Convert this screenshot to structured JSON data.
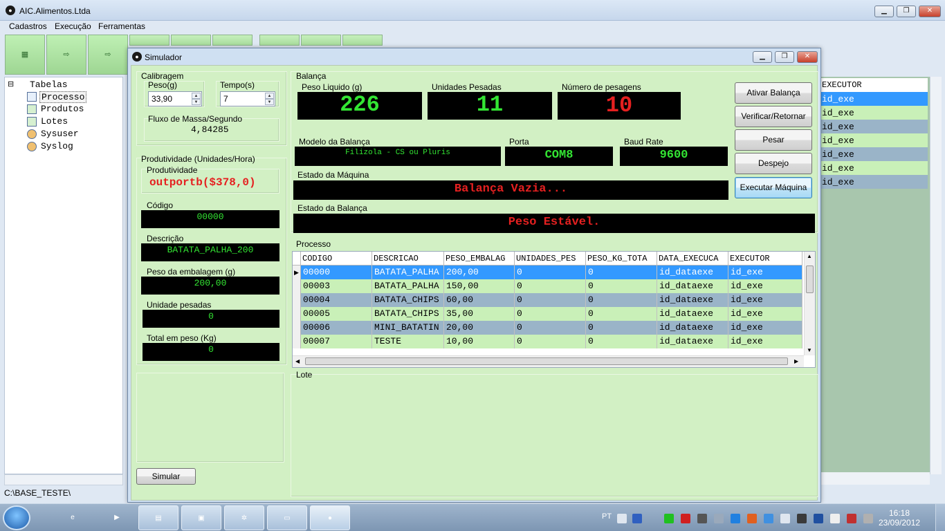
{
  "app": {
    "title": "AIC.Alimentos.Ltda"
  },
  "menu": [
    "Cadastros",
    "Execução",
    "Ferramentas"
  ],
  "tree": {
    "root": "Tabelas",
    "items": [
      "Processo",
      "Produtos",
      "Lotes",
      "Sysuser",
      "Syslog"
    ]
  },
  "status": {
    "path": "C:\\BASE_TESTE\\"
  },
  "background_grid": {
    "header": "EXECUTOR",
    "rows": [
      "id_exe",
      "id_exe",
      "id_exe",
      "id_exe",
      "id_exe",
      "id_exe",
      "id_exe"
    ]
  },
  "dialog": {
    "title": "Simulador",
    "calibragem": {
      "label": "Calibragem",
      "peso_label": "Peso(g)",
      "peso_value": "33,90",
      "tempo_label": "Tempo(s)",
      "tempo_value": "7",
      "fluxo_label": "Fluxo de Massa/Segundo",
      "fluxo_value": "4,84285"
    },
    "produtividade": {
      "label": "Produtividade (Unidades/Hora)",
      "prod_label": "Produtividade",
      "prod_value": "outportb($378,0)",
      "codigo_label": "Código",
      "codigo_value": "00000",
      "descricao_label": "Descrição",
      "descricao_value": "BATATA_PALHA_200",
      "peso_emb_label": "Peso da embalagem (g)",
      "peso_emb_value": "200,00",
      "unid_label": "Unidade pesadas",
      "unid_value": "0",
      "total_label": "Total em peso (Kg)",
      "total_value": "0"
    },
    "balanca": {
      "label": "Balança",
      "peso_liquido_label": "Peso Liquido (g)",
      "peso_liquido_value": "226",
      "unidades_label": "Unidades Pesadas",
      "unidades_value": "11",
      "num_pesagens_label": "Número de pesagens",
      "num_pesagens_value": "10",
      "modelo_label": "Modelo da Balança",
      "modelo_value": "Filizola - CS ou Pluris",
      "porta_label": "Porta",
      "porta_value": "COM8",
      "baud_label": "Baud Rate",
      "baud_value": "9600",
      "estado_maquina_label": "Estado da Máquina",
      "estado_maquina_value": "Balança Vazia...",
      "estado_balanca_label": "Estado da Balança",
      "estado_balanca_value": "Peso Estável."
    },
    "buttons": {
      "ativar": "Ativar Balança",
      "verificar": "Verificar/Retornar",
      "pesar": "Pesar",
      "despejo": "Despejo",
      "executar": "Executar Máquina",
      "simular": "Simular"
    },
    "processo": {
      "label": "Processo",
      "columns": [
        "CODIGO",
        "DESCRICAO",
        "PESO_EMBALAG",
        "UNIDADES_PES",
        "PESO_KG_TOTA",
        "DATA_EXECUCA",
        "EXECUTOR"
      ],
      "rows": [
        [
          "00000",
          "BATATA_PALHA",
          "200,00",
          "0",
          "0",
          "id_dataexe",
          "id_exe"
        ],
        [
          "00003",
          "BATATA_PALHA",
          "150,00",
          "0",
          "0",
          "id_dataexe",
          "id_exe"
        ],
        [
          "00004",
          "BATATA_CHIPS",
          "60,00",
          "0",
          "0",
          "id_dataexe",
          "id_exe"
        ],
        [
          "00005",
          "BATATA_CHIPS",
          "35,00",
          "0",
          "0",
          "id_dataexe",
          "id_exe"
        ],
        [
          "00006",
          "MINI_BATATIN",
          "20,00",
          "0",
          "0",
          "id_dataexe",
          "id_exe"
        ],
        [
          "00007",
          "TESTE",
          "10,00",
          "0",
          "0",
          "id_dataexe",
          "id_exe"
        ]
      ]
    },
    "lote": {
      "label": "Lote"
    }
  },
  "taskbar": {
    "lang": "PT",
    "time": "16:18",
    "date": "23/09/2012"
  },
  "colors": {
    "lcd_green": "#33e533",
    "lcd_red": "#e52020",
    "panel_green": "#d2f0c4",
    "selection": "#3399ff"
  }
}
